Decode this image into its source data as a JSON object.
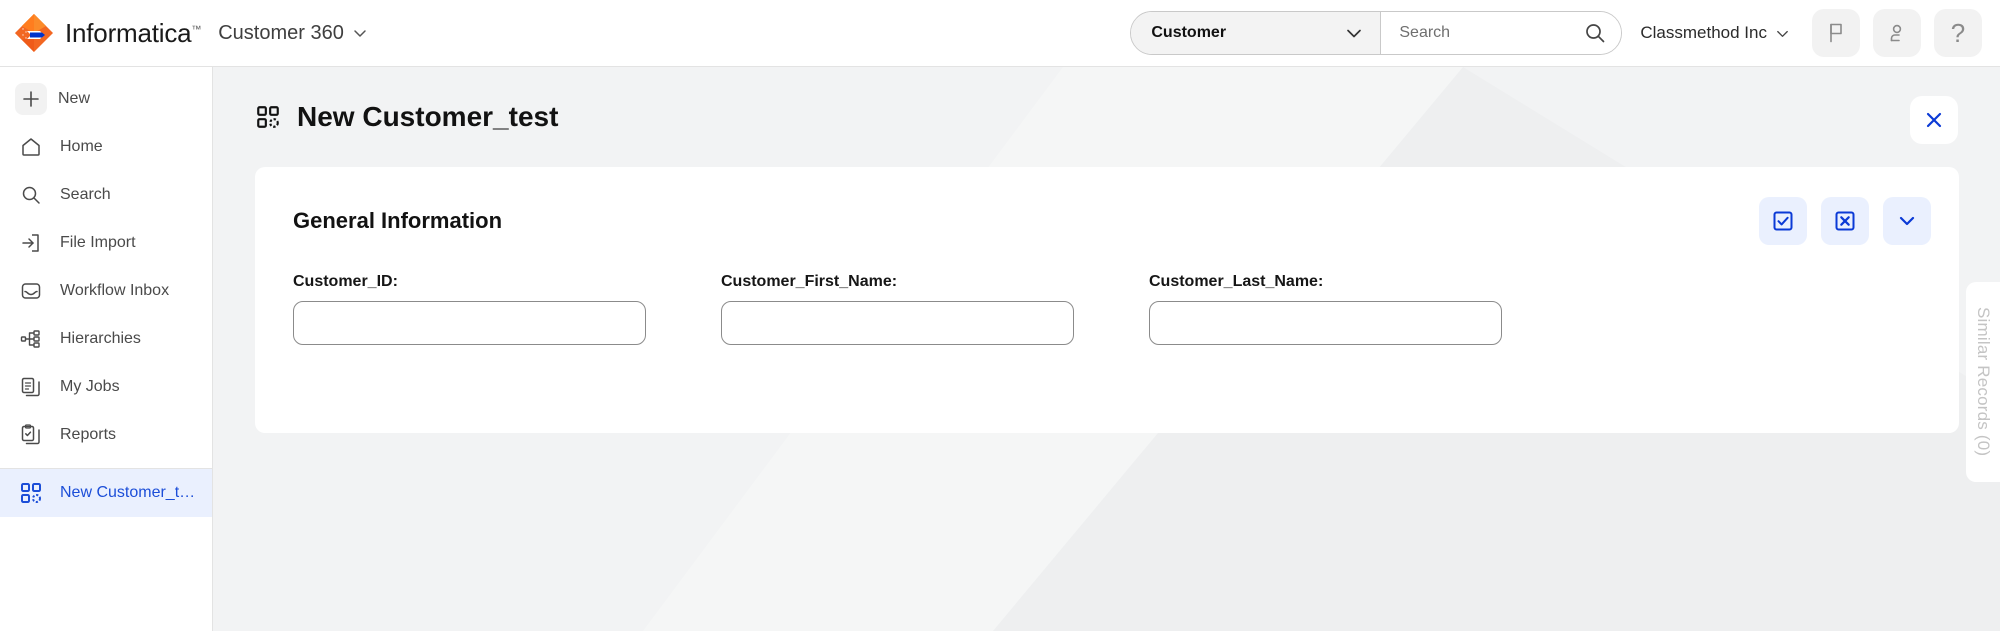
{
  "header": {
    "brand": "Informatica",
    "brand_tm": "™",
    "app_name": "Customer 360",
    "app_chevron_icon": "chevron-down-icon",
    "entity_select": {
      "value": "Customer",
      "chevron_icon": "chevron-down-icon"
    },
    "search": {
      "value": "",
      "placeholder": "Search",
      "icon": "search-icon"
    },
    "tenant": {
      "name": "Classmethod Inc",
      "chevron_icon": "chevron-down-icon"
    },
    "buttons": [
      {
        "name": "flag-icon",
        "label": ""
      },
      {
        "name": "user-icon",
        "label": ""
      },
      {
        "name": "help-icon",
        "label": "?"
      }
    ]
  },
  "sidebar": {
    "items": [
      {
        "label": "New",
        "icon": "plus-icon",
        "active": false
      },
      {
        "label": "Home",
        "icon": "home-icon",
        "active": false
      },
      {
        "label": "Search",
        "icon": "search-icon",
        "active": false
      },
      {
        "label": "File Import",
        "icon": "file-import-icon",
        "active": false
      },
      {
        "label": "Workflow Inbox",
        "icon": "inbox-icon",
        "active": false
      },
      {
        "label": "Hierarchies",
        "icon": "hierarchy-icon",
        "active": false
      },
      {
        "label": "My Jobs",
        "icon": "documents-icon",
        "active": false
      },
      {
        "label": "Reports",
        "icon": "clipboard-check-icon",
        "active": false
      },
      {
        "label": "New Customer_t…",
        "icon": "record-grid-icon",
        "active": true
      }
    ]
  },
  "main": {
    "page_title": "New Customer_test",
    "page_title_icon": "record-grid-icon",
    "close_icon": "close-icon",
    "card": {
      "title": "General Information",
      "actions": [
        {
          "name": "save-button",
          "icon": "checkbox-check-icon"
        },
        {
          "name": "cancel-button",
          "icon": "box-x-icon"
        },
        {
          "name": "collapse-button",
          "icon": "chevron-down-icon"
        }
      ],
      "fields": [
        {
          "label": "Customer_ID:",
          "value": "",
          "placeholder": ""
        },
        {
          "label": "Customer_First_Name:",
          "value": "",
          "placeholder": ""
        },
        {
          "label": "Customer_Last_Name:",
          "value": "",
          "placeholder": ""
        }
      ]
    },
    "side_tab": {
      "label": "Similar Records (0)"
    }
  },
  "colors": {
    "brand_orange": "#ff6600",
    "brand_blue": "#0033cc",
    "accent_blue": "#1c4ed8",
    "active_bg": "#eaf0fe",
    "canvas": "#f2f3f4"
  }
}
